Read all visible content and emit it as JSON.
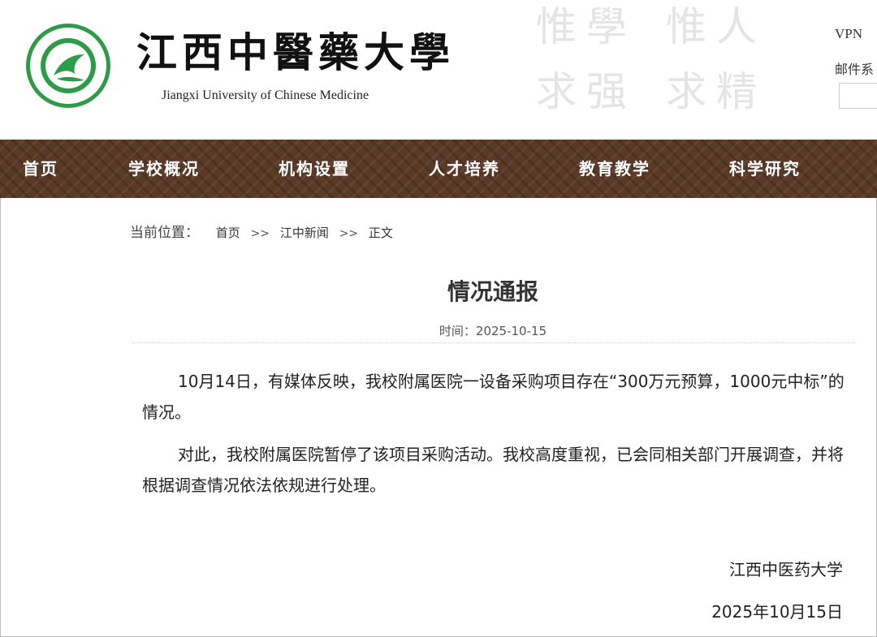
{
  "header": {
    "name_cn": "江西中醫藥大學",
    "name_en": "Jiangxi University of Chinese Medicine",
    "motto": [
      "惟",
      "學",
      "惟",
      "人",
      "求",
      "强",
      "求",
      "精"
    ],
    "links": {
      "vpn": "VPN",
      "mail": "邮件系"
    }
  },
  "nav": {
    "items": [
      "首页",
      "学校概况",
      "机构设置",
      "人才培养",
      "教育教学",
      "科学研究"
    ],
    "colors": {
      "background": "#5a3a26",
      "text": "#ffffff"
    }
  },
  "breadcrumb": {
    "label": "当前位置：",
    "items": [
      "首页",
      "江中新闻",
      "正文"
    ],
    "separator": ">>"
  },
  "article": {
    "title": "情况通报",
    "date": "时间：2025-10-15",
    "paragraphs": [
      "10月14日，有媒体反映，我校附属医院一设备采购项目存在“300万元预算，1000元中标”的情况。",
      "对此，我校附属医院暂停了该项目采购活动。我校高度重视，已会同相关部门开展调查，并将根据调查情况依法依规进行处理。"
    ],
    "signature": "江西中医药大学",
    "signature_date": "2025年10月15日"
  }
}
